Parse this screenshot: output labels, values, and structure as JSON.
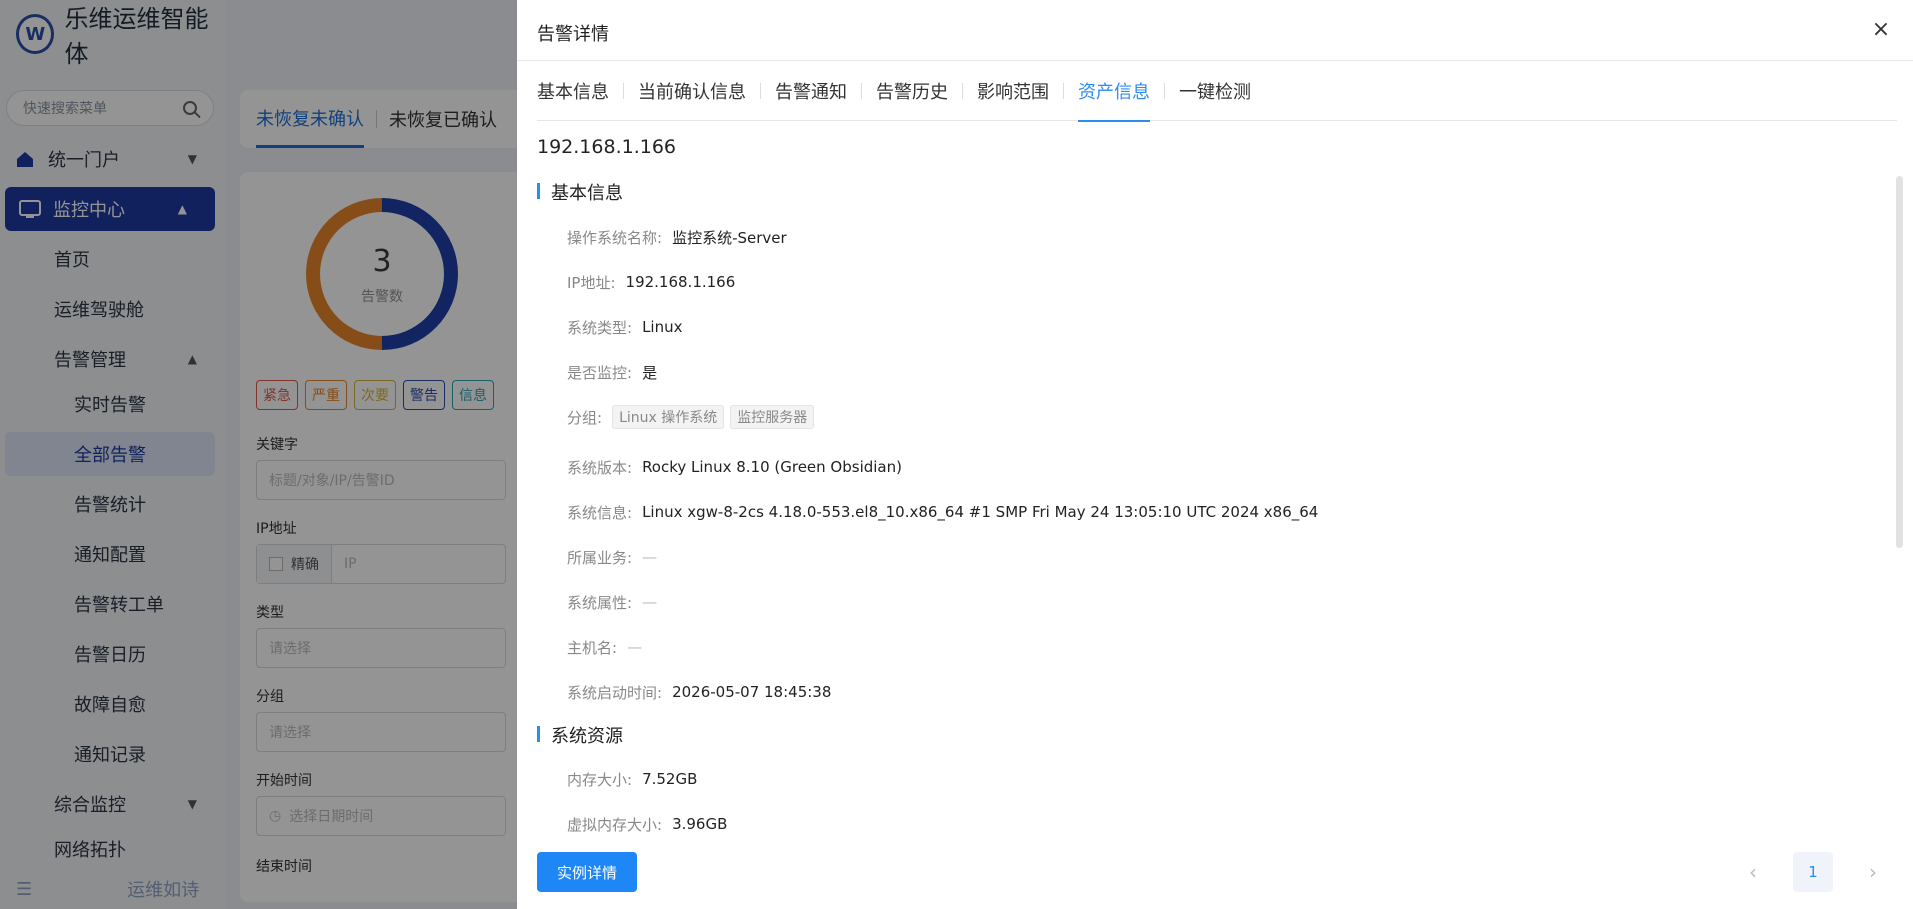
{
  "brand": {
    "name": "乐维运维智能体",
    "logo_letter": "W"
  },
  "sidebar": {
    "search_placeholder": "快速搜索菜单",
    "items": [
      {
        "label": "统一门户",
        "icon": "home-icon"
      },
      {
        "label": "监控中心",
        "icon": "monitor-icon"
      },
      {
        "label": "首页"
      },
      {
        "label": "运维驾驶舱"
      },
      {
        "label": "告警管理"
      },
      {
        "label": "实时告警"
      },
      {
        "label": "全部告警"
      },
      {
        "label": "告警统计"
      },
      {
        "label": "通知配置"
      },
      {
        "label": "告警转工单"
      },
      {
        "label": "告警日历"
      },
      {
        "label": "故障自愈"
      },
      {
        "label": "通知记录"
      },
      {
        "label": "综合监控"
      },
      {
        "label": "网络拓扑"
      }
    ],
    "footer_text": "运维如诗"
  },
  "main": {
    "tabs": [
      "未恢复未确认",
      "未恢复已确认"
    ],
    "donut": {
      "count": "3",
      "label": "告警数",
      "ratio_blue": 0.5
    },
    "levels": [
      {
        "label": "紧急",
        "color": "#e05a4a"
      },
      {
        "label": "严重",
        "color": "#e8862a"
      },
      {
        "label": "次要",
        "color": "#d8b23a"
      },
      {
        "label": "警告",
        "color": "#2a4fa8"
      },
      {
        "label": "信息",
        "color": "#2aa7b5"
      }
    ],
    "filters": {
      "keyword_label": "关键字",
      "keyword_placeholder": "标题/对象/IP/告警ID",
      "ip_label": "IP地址",
      "exact_label": "精确",
      "ip_placeholder": "IP",
      "type_label": "类型",
      "type_placeholder": "请选择",
      "group_label": "分组",
      "group_placeholder": "请选择",
      "start_label": "开始时间",
      "start_placeholder": "选择日期时间",
      "end_label": "结束时间"
    }
  },
  "drawer": {
    "title": "告警详情",
    "tabs": [
      "基本信息",
      "当前确认信息",
      "告警通知",
      "告警历史",
      "影响范围",
      "资产信息",
      "一键检测"
    ],
    "active_tab": "资产信息",
    "ip": "192.168.1.166",
    "section_basic": "基本信息",
    "basic": {
      "os_name_k": "操作系统名称:",
      "os_name_v": "监控系统-Server",
      "ip_k": "IP地址:",
      "ip_v": "192.168.1.166",
      "sys_type_k": "系统类型:",
      "sys_type_v": "Linux",
      "monitored_k": "是否监控:",
      "monitored_v": "是",
      "group_k": "分组:",
      "group_tags": [
        "Linux 操作系统",
        "监控服务器"
      ],
      "version_k": "系统版本:",
      "version_v": "Rocky Linux 8.10 (Green Obsidian)",
      "info_k": "系统信息:",
      "info_v": "Linux xgw-8-2cs 4.18.0-553.el8_10.x86_64 #1 SMP Fri May 24 13:05:10 UTC 2024 x86_64",
      "business_k": "所属业务:",
      "business_v": "—",
      "attr_k": "系统属性:",
      "attr_v": "—",
      "host_k": "主机名:",
      "host_v": "—",
      "boot_k": "系统启动时间:",
      "boot_v": "2026-05-07 18:45:38"
    },
    "section_resource": "系统资源",
    "resource": {
      "mem_k": "内存大小:",
      "mem_v": "7.52GB",
      "vmem_k": "虚拟内存大小:",
      "vmem_v": "3.96GB"
    },
    "button_label": "实例详情",
    "page": "1",
    "close_glyph": "×",
    "prev_glyph": "‹",
    "next_glyph": "›"
  }
}
